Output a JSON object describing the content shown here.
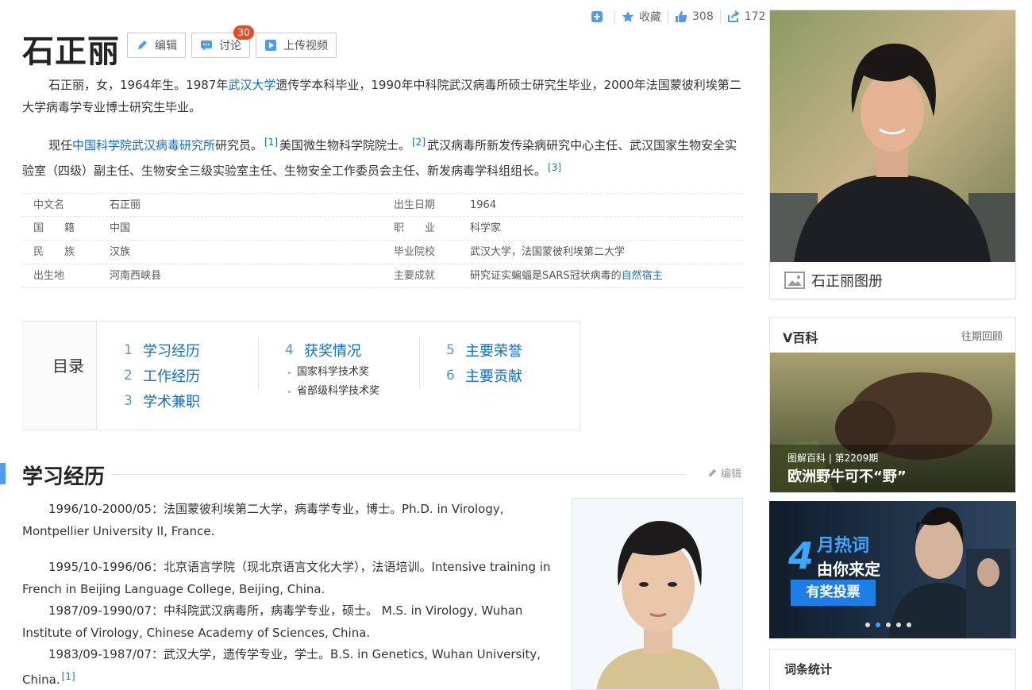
{
  "toolbar": {
    "collect_label": "收藏",
    "like_count": "308",
    "share_count": "172"
  },
  "title": "石正丽",
  "title_buttons": {
    "edit": "编辑",
    "discuss": "讨论",
    "discuss_badge": "30",
    "upload_video": "上传视频"
  },
  "summary": {
    "p1_a": "石正丽，女，1964年生。1987年",
    "p1_link": "武汉大学",
    "p1_b": "遗传学本科毕业，1990年中科院武汉病毒所硕士研究生毕业，2000年法国蒙彼利埃第二大学病毒学专业博士研究生毕业。",
    "p2_a": "现任",
    "p2_link": "中国科学院武汉病毒研究所",
    "p2_b": "研究员。",
    "ref1": "[1]",
    "p2_c": "美国微生物科学院院士。",
    "ref2": "[2]",
    "p2_d": "武汉病毒所新发传染病研究中心主任、武汉国家生物安全实验室（四级）副主任、生物安全三级实验室主任、生物安全工作委员会主任、新发病毒学科组组长。",
    "ref3": "[3]"
  },
  "info": [
    {
      "k1": "中文名",
      "v1": "石正丽",
      "k2": "出生日期",
      "v2": "1964"
    },
    {
      "k1": "国　　籍",
      "v1": "中国",
      "k2": "职　　业",
      "v2": "科学家"
    },
    {
      "k1": "民　　族",
      "v1": "汉族",
      "k2": "毕业院校",
      "v2": "武汉大学，法国蒙彼利埃第二大学"
    },
    {
      "k1": "出生地",
      "v1": "河南西峡县",
      "k2": "主要成就",
      "v2a": "研究证实蝙蝠是SARS冠状病毒的",
      "v2link": "自然宿主"
    }
  ],
  "catalog": {
    "title": "目录",
    "items": [
      {
        "num": "1",
        "label": "学习经历"
      },
      {
        "num": "2",
        "label": "工作经历"
      },
      {
        "num": "3",
        "label": "学术兼职"
      },
      {
        "num": "4",
        "label": "获奖情况"
      },
      {
        "num": "5",
        "label": "主要荣誉"
      },
      {
        "num": "6",
        "label": "主要贡献"
      }
    ],
    "subs": [
      "国家科学技术奖",
      "省部级科学技术奖"
    ]
  },
  "section": {
    "title": "学习经历",
    "edit": "编辑"
  },
  "education": [
    {
      "a": "1996/10-2000/05：",
      "b": "法国蒙彼利埃第二大学，病毒学专业，博士。Ph.D. in Virology, Montpellier University II, France."
    },
    {
      "a": "1995/10-1996/06：",
      "b": "北京语言学院（现北京语言文化大学），法语培训。Intensive training in French in Beijing Language College, Beijing, China."
    },
    {
      "a": "1987/09-1990/07：",
      "b": "中科院武汉病毒所，病毒学专业，硕士。 M.S. in Virology, Wuhan Institute of Virology, Chinese Academy of Sciences, China."
    },
    {
      "a": "1983/09-1987/07：",
      "b": "武汉大学，遗传学专业，学士。B.S. in Genetics, Wuhan University, China.",
      "ref": "[1]"
    }
  ],
  "album": {
    "caption": "石正丽图册"
  },
  "vbaike": {
    "title": "V百科",
    "more": "往期回顾",
    "tag": "图解百科 | 第2209期",
    "caption": "欧洲野牛可不“野”"
  },
  "banner": {
    "line1": "月热词",
    "num": "4",
    "line2": "由你来定",
    "button": "有奖投票"
  },
  "stats": {
    "title": "词条统计"
  }
}
